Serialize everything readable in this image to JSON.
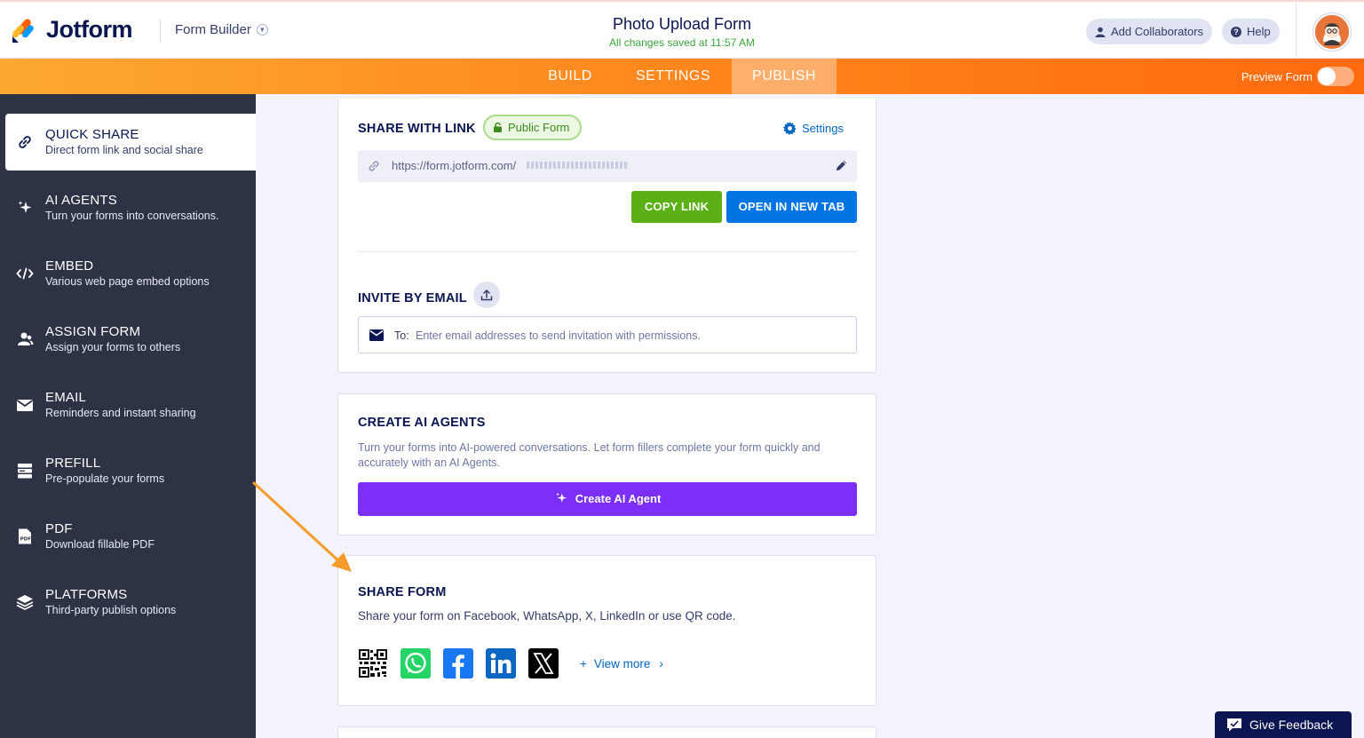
{
  "header": {
    "logo_text": "Jotform",
    "builder_label": "Form Builder",
    "form_title": "Photo Upload Form",
    "saved_status": "All changes saved at 11:57 AM",
    "add_collaborators": "Add Collaborators",
    "help": "Help"
  },
  "nav": {
    "tabs": [
      "BUILD",
      "SETTINGS",
      "PUBLISH"
    ],
    "active_tab": "PUBLISH",
    "preview_label": "Preview Form",
    "preview_enabled": false
  },
  "sidebar": {
    "items": [
      {
        "title": "QUICK SHARE",
        "desc": "Direct form link and social share",
        "icon": "link-icon",
        "active": true
      },
      {
        "title": "AI AGENTS",
        "desc": "Turn your forms into conversations.",
        "icon": "sparkle-icon",
        "active": false
      },
      {
        "title": "EMBED",
        "desc": "Various web page embed options",
        "icon": "code-icon",
        "active": false
      },
      {
        "title": "ASSIGN FORM",
        "desc": "Assign your forms to others",
        "icon": "users-icon",
        "active": false
      },
      {
        "title": "EMAIL",
        "desc": "Reminders and instant sharing",
        "icon": "envelope-icon",
        "active": false
      },
      {
        "title": "PREFILL",
        "desc": "Pre-populate your forms",
        "icon": "prefill-icon",
        "active": false
      },
      {
        "title": "PDF",
        "desc": "Download fillable PDF",
        "icon": "pdf-icon",
        "active": false
      },
      {
        "title": "PLATFORMS",
        "desc": "Third-party publish options",
        "icon": "layers-icon",
        "active": false
      }
    ]
  },
  "share_link": {
    "title": "SHARE WITH LINK",
    "badge": "Public Form",
    "settings": "Settings",
    "url": "https://form.jotform.com/",
    "copy_link": "COPY LINK",
    "open_new_tab": "OPEN IN NEW TAB"
  },
  "invite": {
    "title": "INVITE BY EMAIL",
    "to_label": "To:",
    "placeholder": "Enter email addresses to send invitation with permissions."
  },
  "ai_agents": {
    "title": "CREATE AI AGENTS",
    "description": "Turn your forms into AI-powered conversations. Let form fillers complete your form quickly and accurately with an AI Agents.",
    "button": "Create AI Agent"
  },
  "share_form": {
    "title": "SHARE FORM",
    "description": "Share your form on Facebook, WhatsApp, X, LinkedIn or use QR code.",
    "icons": [
      "qr-code-icon",
      "whatsapp-icon",
      "facebook-icon",
      "linkedin-icon",
      "x-icon"
    ],
    "view_more": "View more"
  },
  "feedback": {
    "label": "Give Feedback"
  },
  "colors": {
    "nav_orange": "#ff8a1f",
    "sidebar_bg": "#2d3345",
    "copy_green": "#5ab014",
    "open_blue": "#0075e3",
    "ai_purple": "#7b2ff7",
    "arrow_orange": "#f59b2b"
  }
}
